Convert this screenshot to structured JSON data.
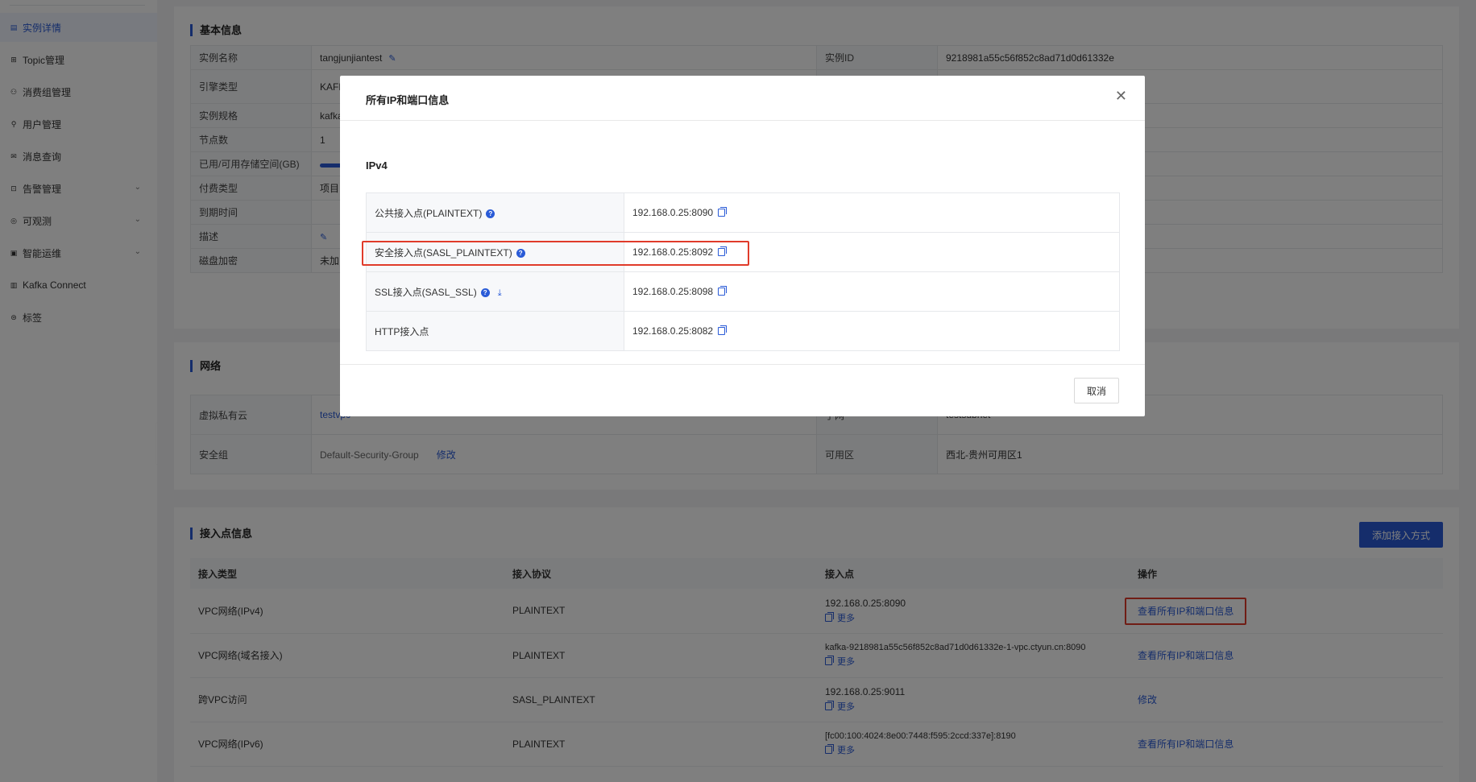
{
  "sidebar": {
    "items": [
      {
        "label": "实例详情",
        "icon": "document-icon",
        "active": true
      },
      {
        "label": "Topic管理",
        "icon": "grid-icon"
      },
      {
        "label": "消费组管理",
        "icon": "group-icon"
      },
      {
        "label": "用户管理",
        "icon": "user-icon"
      },
      {
        "label": "消息查询",
        "icon": "mail-icon"
      },
      {
        "label": "告警管理",
        "icon": "alarm-icon",
        "expandable": true
      },
      {
        "label": "可观测",
        "icon": "eye-icon",
        "expandable": true
      },
      {
        "label": "智能运维",
        "icon": "robot-icon",
        "expandable": true
      },
      {
        "label": "Kafka Connect",
        "icon": "connect-icon"
      },
      {
        "label": "标签",
        "icon": "tag-icon"
      }
    ]
  },
  "basic": {
    "title": "基本信息",
    "rows": [
      {
        "label": "实例名称",
        "value": "tangjunjiantest",
        "label2": "实例ID",
        "value2": "9218981a55c56f852c8ad71d0d61332e"
      },
      {
        "label": "引擎类型",
        "value": "KAFK"
      },
      {
        "label": "实例规格",
        "value": "kafka"
      },
      {
        "label": "节点数",
        "value": "1"
      },
      {
        "label": "已用/可用存储空间(GB)",
        "value": ""
      },
      {
        "label": "付费类型",
        "value": "项目"
      },
      {
        "label": "到期时间",
        "value": ""
      },
      {
        "label": "描述",
        "value": ""
      },
      {
        "label": "磁盘加密",
        "value": "未加"
      }
    ]
  },
  "network": {
    "title": "网络",
    "vpc_label": "虚拟私有云",
    "vpc_value": "testvpc",
    "subnet_label": "子网",
    "subnet_value": "testsubnet",
    "sg_label": "安全组",
    "sg_value": "Default-Security-Group",
    "sg_edit": "修改",
    "az_label": "可用区",
    "az_value": "西北-贵州可用区1"
  },
  "endpoints": {
    "title": "接入点信息",
    "add_button": "添加接入方式",
    "headers": [
      "接入类型",
      "接入协议",
      "接入点",
      "操作"
    ],
    "more_label": "更多",
    "rows": [
      {
        "type": "VPC网络(IPv4)",
        "protocol": "PLAINTEXT",
        "endpoint": "192.168.0.25:8090",
        "action": "查看所有IP和端口信息"
      },
      {
        "type": "VPC网络(域名接入)",
        "protocol": "PLAINTEXT",
        "endpoint": "kafka-9218981a55c56f852c8ad71d0d61332e-1-vpc.ctyun.cn:8090",
        "action": "查看所有IP和端口信息"
      },
      {
        "type": "跨VPC访问",
        "protocol": "SASL_PLAINTEXT",
        "endpoint": "192.168.0.25:9011",
        "action": "修改"
      },
      {
        "type": "VPC网络(IPv6)",
        "protocol": "PLAINTEXT",
        "endpoint": "[fc00:100:4024:8e00:7448:f595:2ccd:337e]:8190",
        "action": "查看所有IP和端口信息"
      }
    ]
  },
  "modal": {
    "title": "所有IP和端口信息",
    "section": "IPv4",
    "rows": [
      {
        "label": "公共接入点(PLAINTEXT)",
        "value": "192.168.0.25:8090"
      },
      {
        "label": "安全接入点(SASL_PLAINTEXT)",
        "value": "192.168.0.25:8092"
      },
      {
        "label": "SSL接入点(SASL_SSL)",
        "value": "192.168.0.25:8098"
      },
      {
        "label": "HTTP接入点",
        "value": "192.168.0.25:8082"
      }
    ],
    "cancel": "取消"
  },
  "colors": {
    "accent": "#2a5bd7",
    "highlight": "#e03b2a"
  }
}
